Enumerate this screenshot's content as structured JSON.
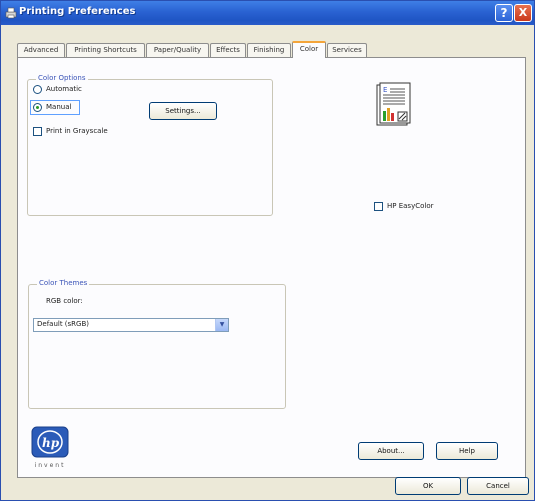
{
  "window": {
    "title": "Printing Preferences"
  },
  "titlebar_buttons": {
    "help": "?",
    "close": "X"
  },
  "tabs": [
    {
      "label": "Advanced",
      "active": false
    },
    {
      "label": "Printing Shortcuts",
      "active": false
    },
    {
      "label": "Paper/Quality",
      "active": false
    },
    {
      "label": "Effects",
      "active": false
    },
    {
      "label": "Finishing",
      "active": false
    },
    {
      "label": "Color",
      "active": true
    },
    {
      "label": "Services",
      "active": false
    }
  ],
  "color_options": {
    "legend": "Color Options",
    "automatic_label": "Automatic",
    "manual_label": "Manual",
    "selected": "Manual",
    "settings_button": "Settings...",
    "print_grayscale_label": "Print in Grayscale",
    "print_grayscale_checked": false
  },
  "hp_easycolor": {
    "label": "HP EasyColor",
    "checked": false
  },
  "color_themes": {
    "legend": "Color Themes",
    "rgb_label": "RGB color:",
    "selected_value": "Default (sRGB)"
  },
  "footer": {
    "about_button": "About...",
    "help_button": "Help",
    "ok_button": "OK",
    "cancel_button": "Cancel",
    "logo_text": "invent"
  },
  "colors": {
    "titlebar": "#2a62d2",
    "active_tab_accent": "#f4a53a",
    "group_legend": "#3c55b8",
    "dialog_bg": "#ece9d8"
  },
  "icons": [
    "printer-app-icon",
    "help-icon",
    "close-icon",
    "color-document-preview-icon",
    "dropdown-arrow-icon",
    "hp-logo-icon"
  ]
}
